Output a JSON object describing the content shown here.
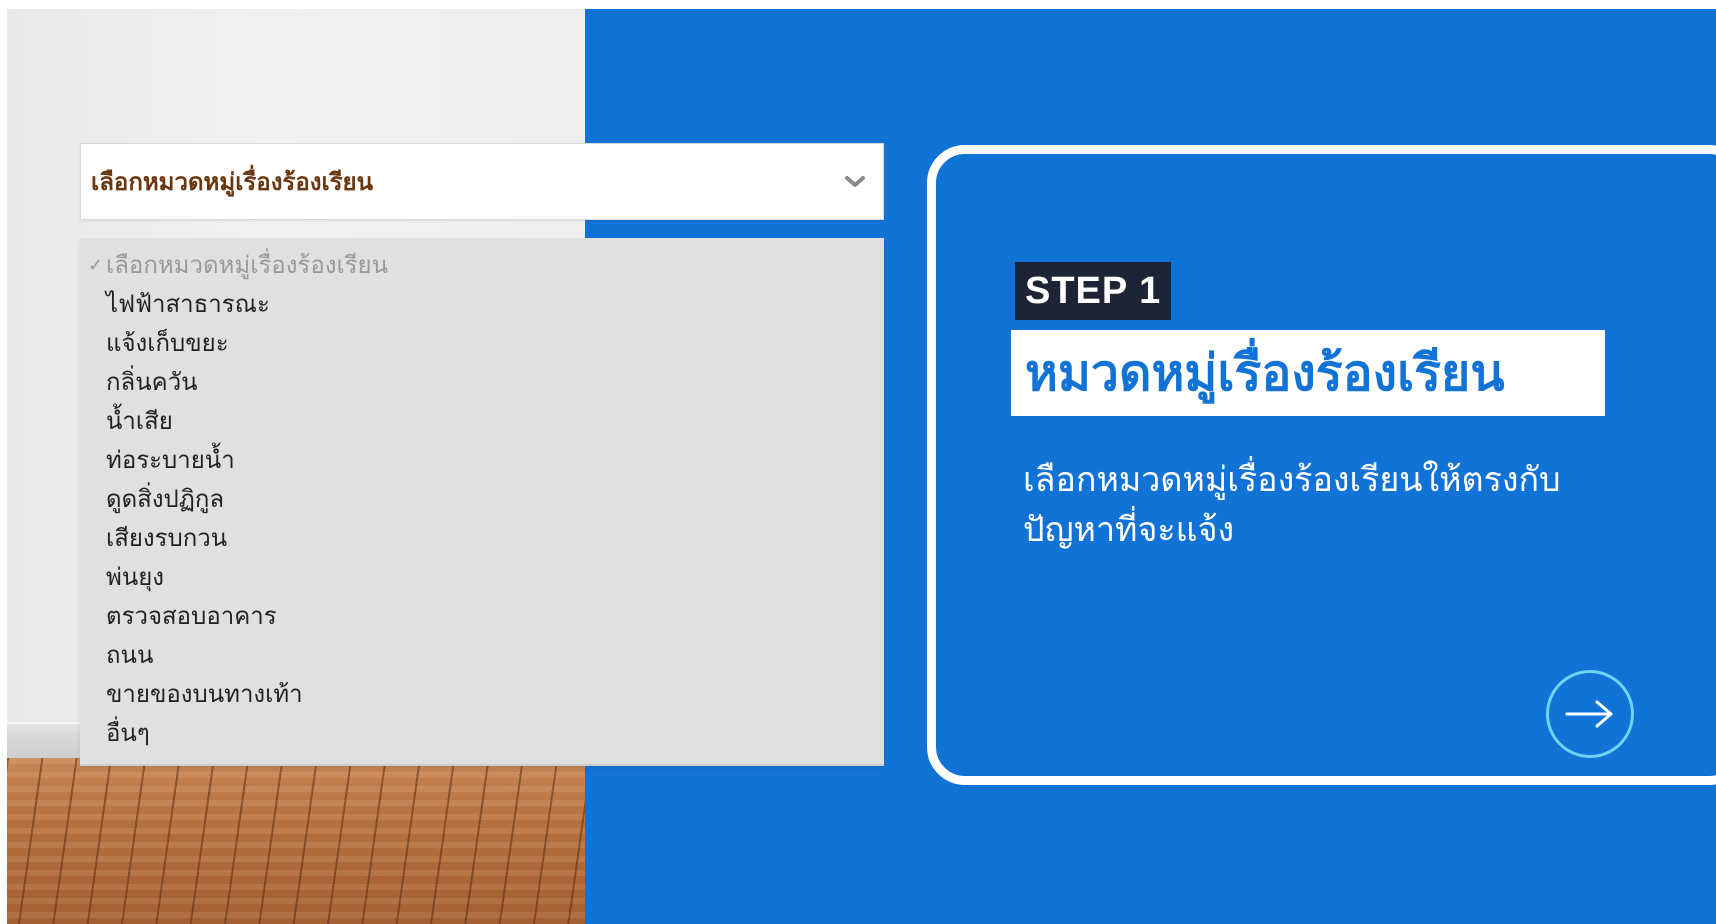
{
  "select": {
    "label": "เลือกหมวดหมู่เรื่องร้องเรียน",
    "options": [
      "เลือกหมวดหมู่เรื่องร้องเรียน",
      "ไฟฟ้าสาธารณะ",
      "แจ้งเก็บขยะ",
      "กลิ่นควัน",
      "น้ำเสีย",
      "ท่อระบายน้ำ",
      "ดูดสิ่งปฏิกูล",
      "เสียงรบกวน",
      "พ่นยุง",
      "ตรวจสอบอาคาร",
      "ถนน",
      "ขายของบนทางเท้า",
      "อื่นๆ"
    ],
    "selected_index": 0
  },
  "step": {
    "badge": "STEP 1",
    "title": "หมวดหมู่เรื่องร้องเรียน",
    "description_line1": "เลือกหมวดหมู่เรื่องร้องเรียนให้ตรงกับ",
    "description_line2": "ปัญหาที่จะแจ้ง"
  },
  "icons": {
    "dropdown": "chevron-down-icon",
    "next": "arrow-right-icon",
    "check": "checkmark-icon"
  },
  "colors": {
    "panel_blue": "#1273d6",
    "badge_dark": "#1c2436",
    "select_text": "#6b3610",
    "arrow_circle": "#6fd3f3"
  }
}
